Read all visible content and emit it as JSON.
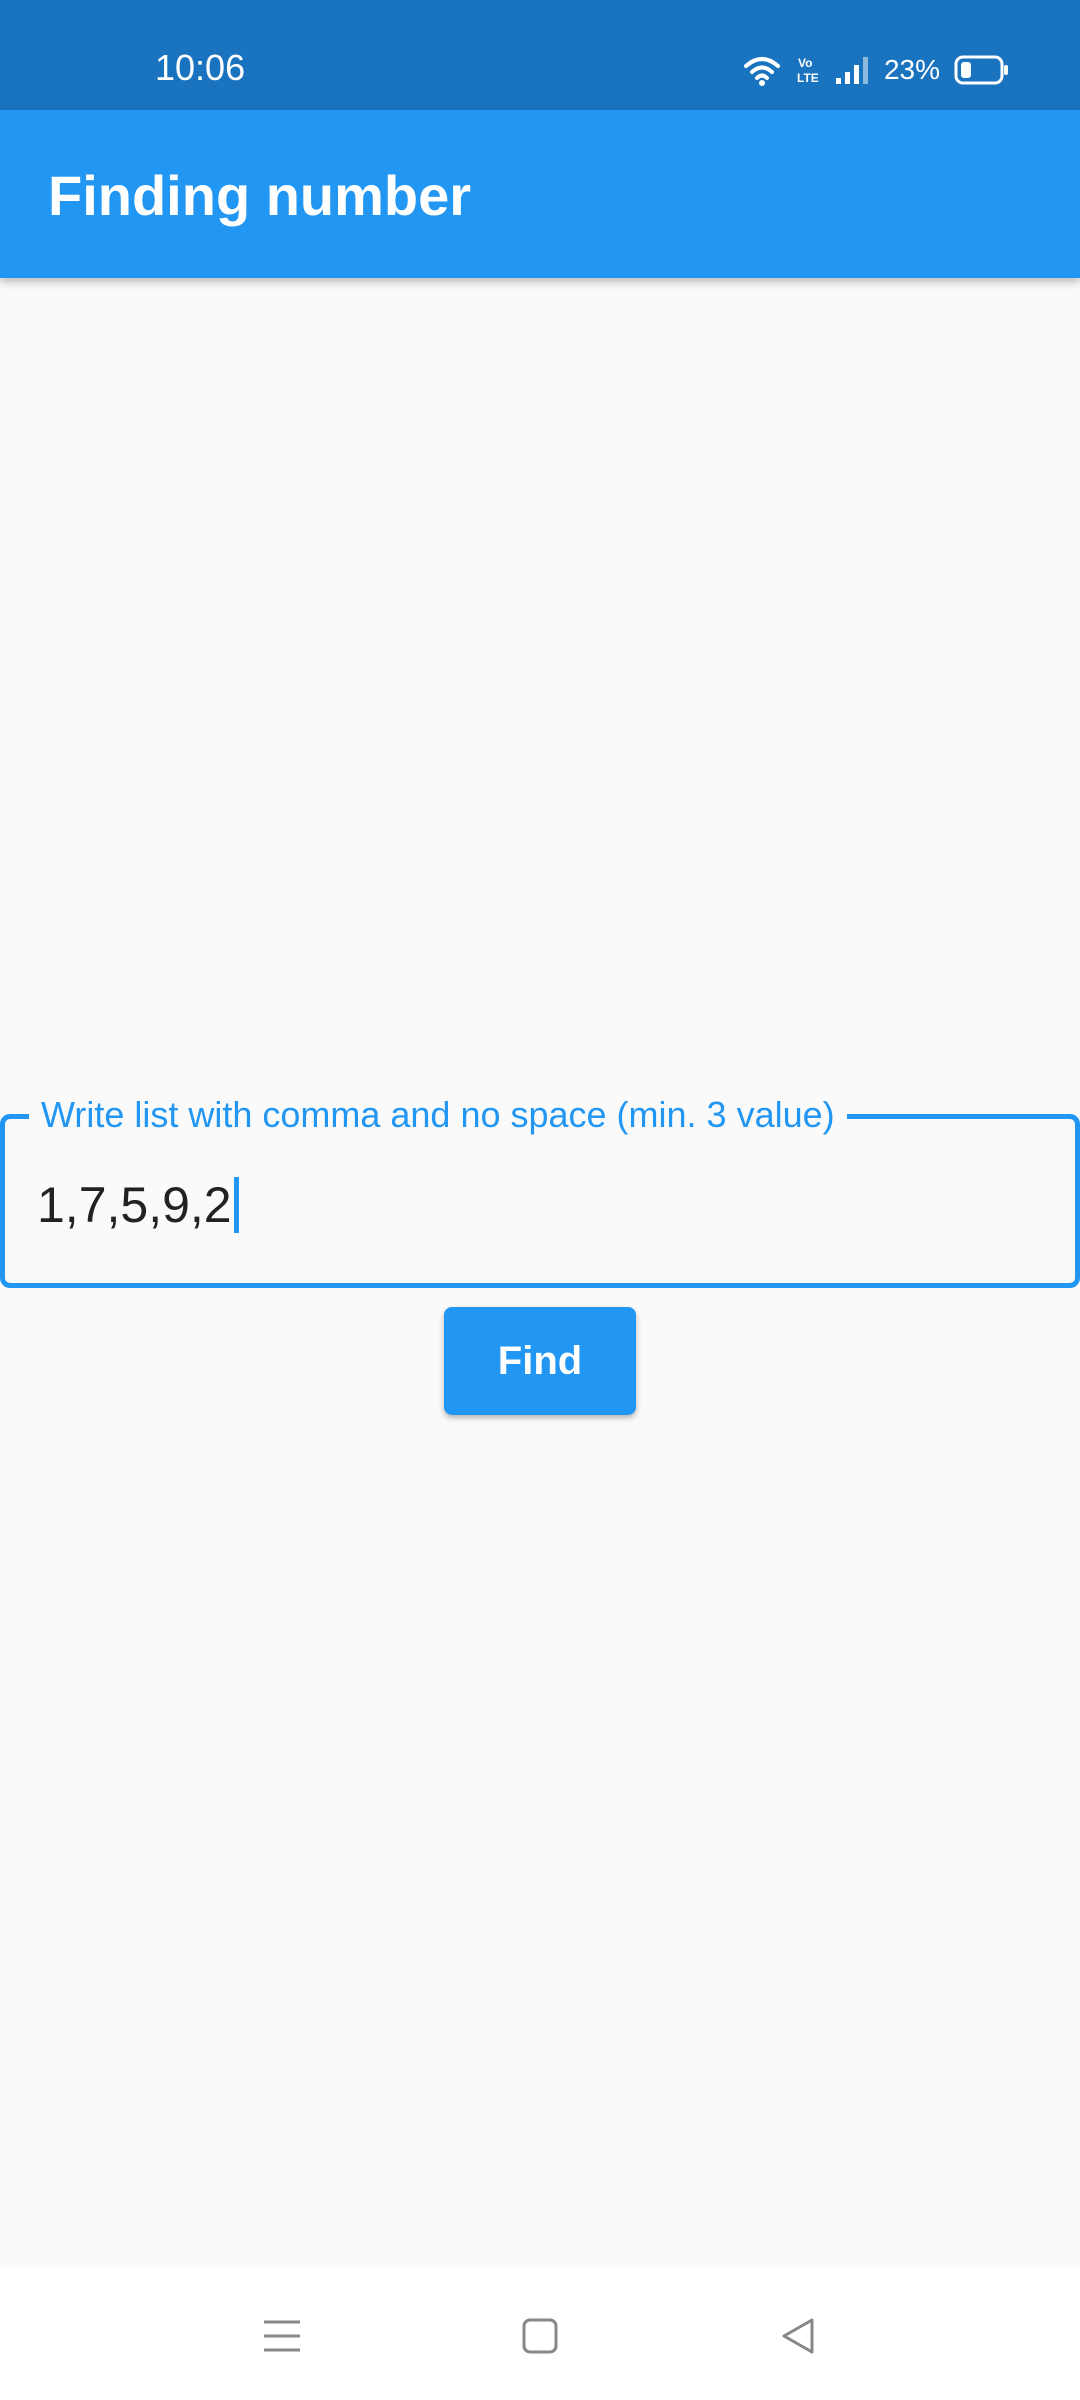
{
  "status_bar": {
    "time": "10:06",
    "battery": "23%",
    "icons": [
      "wifi-icon",
      "volte-icon",
      "signal-icon",
      "battery-icon"
    ]
  },
  "app_bar": {
    "title": "Finding number"
  },
  "form": {
    "label": "Write list with comma and no space (min. 3 value)",
    "value": "1,7,5,9,2",
    "button_label": "Find"
  },
  "nav_bar": {
    "icons": [
      "menu-icon",
      "home-icon",
      "back-icon"
    ]
  },
  "colors": {
    "status_bar": "#1a73bf",
    "primary": "#2196f3",
    "background": "#fafafa"
  }
}
